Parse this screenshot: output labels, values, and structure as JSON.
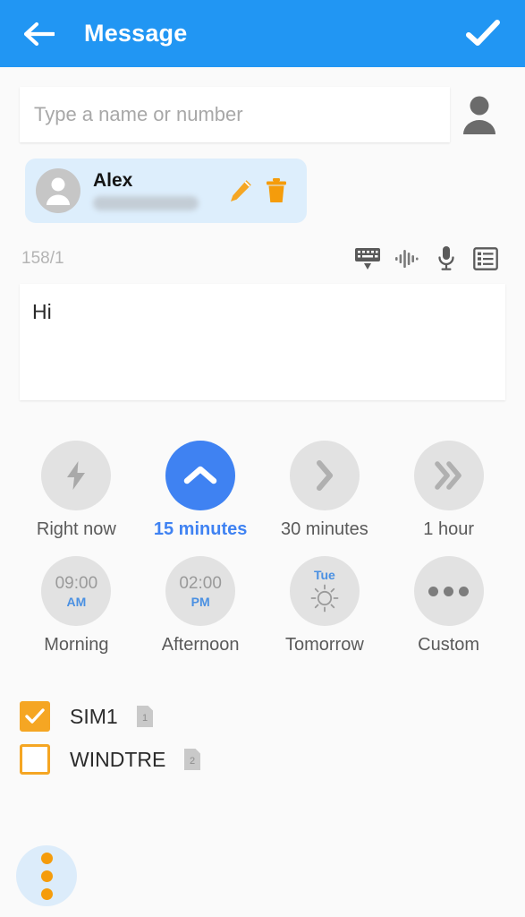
{
  "theme": {
    "header_blue": "#2196f3",
    "accent_blue": "#3f82f2",
    "accent_orange": "#f5a623",
    "chip_blue": "#ddeefc",
    "page_bg": "#fafafa",
    "circle_gray": "#e2e2e2"
  },
  "header": {
    "title": "Message",
    "back_icon": "arrow-left-icon",
    "confirm_icon": "check-icon"
  },
  "recipient": {
    "placeholder": "Type a name or number",
    "value": "",
    "picker_icon": "person-icon"
  },
  "contact_chip": {
    "name": "Alex",
    "number": "",
    "avatar_icon": "person-avatar-icon",
    "edit_icon": "pencil-icon",
    "delete_icon": "trash-icon"
  },
  "compose": {
    "counter": "158/1",
    "message": "Hi",
    "tools": [
      {
        "name": "keyboard-hide-icon"
      },
      {
        "name": "assistant-waveform-icon"
      },
      {
        "name": "microphone-icon"
      },
      {
        "name": "templates-list-icon"
      }
    ]
  },
  "schedule": {
    "rows": [
      [
        {
          "label": "Right now",
          "icon": "lightning-bolt-icon",
          "selected": false
        },
        {
          "label": "15 minutes",
          "icon": "chevron-up-icon",
          "selected": true
        },
        {
          "label": "30 minutes",
          "icon": "chevron-right-icon",
          "selected": false
        },
        {
          "label": "1 hour",
          "icon": "double-chevron-right-icon",
          "selected": false
        }
      ],
      [
        {
          "label": "Morning",
          "icon": "clock-time-icon",
          "time": "09:00",
          "meridiem": "AM",
          "selected": false
        },
        {
          "label": "Afternoon",
          "icon": "clock-time-icon",
          "time": "02:00",
          "meridiem": "PM",
          "selected": false
        },
        {
          "label": "Tomorrow",
          "icon": "sun-icon",
          "day": "Tue",
          "selected": false
        },
        {
          "label": "Custom",
          "icon": "more-horizontal-icon",
          "selected": false
        }
      ]
    ]
  },
  "sims": [
    {
      "label": "SIM1",
      "checked": true,
      "slot": "1",
      "badge_icon": "sim-card-icon"
    },
    {
      "label": "WINDTRE",
      "checked": false,
      "slot": "2",
      "badge_icon": "sim-card-icon"
    }
  ],
  "fab": {
    "icon": "more-vertical-icon"
  }
}
